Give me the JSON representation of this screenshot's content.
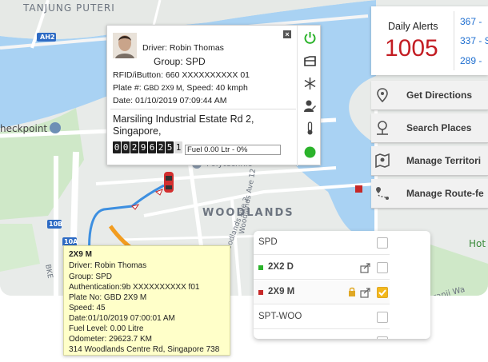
{
  "map": {
    "labels": {
      "tanjung": "TANJUNG PUTERI",
      "checkpoint": "heckpoint",
      "woodlands": "WOODLANDS",
      "poly": "Polytechnic",
      "woodlands_ave2": "Woodlands Ave 2",
      "woodlands_ave12": "Woodlands Ave 12",
      "bke": "BKE",
      "ah2": "AH2",
      "r10b": "10B",
      "r10a": "10A",
      "hotel": "Hot",
      "kranji": "ranji Wa"
    }
  },
  "popup": {
    "driver": "Driver: Robin Thomas",
    "group": "Group: SPD",
    "rfid": "RFID/iButton: 660 XXXXXXXXXX 01",
    "plate_prefix": "Plate #:",
    "plate_value": "GBD 2X9 M",
    "speed": ", Speed: 40 kmph",
    "date": "Date: 01/10/2019 07:09:44 AM",
    "address_line1": "Marsiling Industrial Estate Rd 2,",
    "address_line2": "Singapore,",
    "odometer_digits": [
      "0",
      "0",
      "2",
      "9",
      "6",
      "2",
      "5",
      "1"
    ],
    "fuel": "Fuel 0.00 Ltr - 0%",
    "close": "×"
  },
  "alerts": {
    "title": "Daily Alerts",
    "count": "1005",
    "links": [
      "367 -",
      "337 - S",
      "289 -"
    ]
  },
  "menu": [
    {
      "label": "Get Directions",
      "icon": "directions-pin-icon"
    },
    {
      "label": "Search Places",
      "icon": "search-place-icon"
    },
    {
      "label": "Manage Territori",
      "icon": "territory-map-icon"
    },
    {
      "label": "Manage Route-fe",
      "icon": "route-pin-icon"
    }
  ],
  "vehicles": [
    {
      "name": "SPD",
      "color": "",
      "lock": false,
      "share": false,
      "checked": false
    },
    {
      "name": "2X2 D",
      "color": "#2bb32b",
      "lock": false,
      "share": true,
      "checked": false
    },
    {
      "name": "2X9 M",
      "color": "#c62828",
      "lock": true,
      "share": true,
      "checked": true
    },
    {
      "name": "SPT-WOO",
      "color": "",
      "lock": false,
      "share": false,
      "checked": false
    }
  ],
  "tooltip": {
    "title": "2X9 M",
    "driver": "Driver: Robin Thomas",
    "group": "Group: SPD",
    "auth": "Authentication:9b XXXXXXXXXX f01",
    "plate": "Plate No: GBD 2X9 M",
    "speed": "Speed: 45",
    "date": "Date:01/10/2019 07:00:01 AM",
    "fuel": "Fuel Level: 0.00 Litre",
    "odometer": "Odometer: 29623.7 KM",
    "address": "314 Woodlands Centre Rd, Singapore 738"
  },
  "colors": {
    "accent_red": "#c31d23",
    "link_blue": "#1f6fd0",
    "status_green": "#2bb32b",
    "route_blue": "#3d8fe0",
    "arrow_orange": "#f29c1f"
  }
}
